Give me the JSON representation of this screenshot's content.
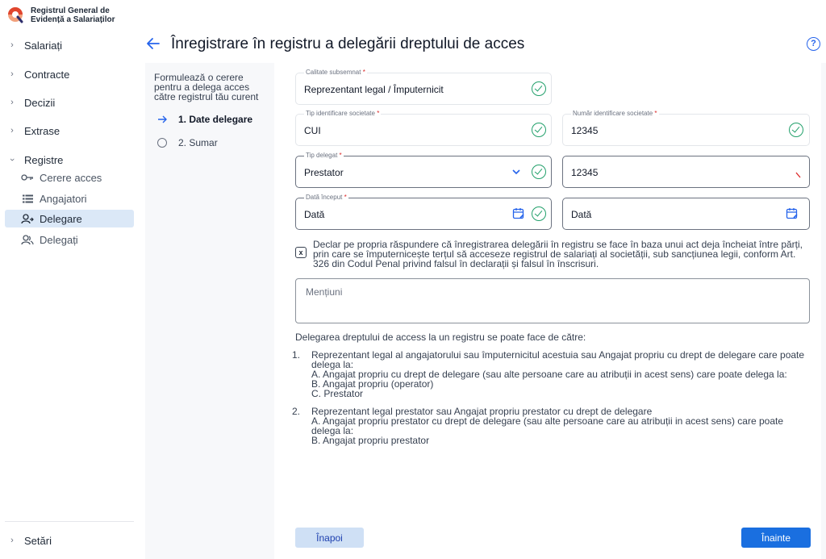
{
  "app": {
    "title_line1": "Registrul General de",
    "title_line2": "Evidență a Salariaților"
  },
  "sidebar": {
    "items": [
      {
        "label": "Salariați"
      },
      {
        "label": "Contracte"
      },
      {
        "label": "Decizii"
      },
      {
        "label": "Extrase"
      },
      {
        "label": "Registre"
      }
    ],
    "sub_items": [
      {
        "label": "Cerere acces",
        "icon": "key-icon"
      },
      {
        "label": "Angajatori",
        "icon": "list-icon"
      },
      {
        "label": "Delegare",
        "icon": "delegate-icon",
        "active": true
      },
      {
        "label": "Delegați",
        "icon": "users-icon"
      }
    ],
    "settings_label": "Setări"
  },
  "header": {
    "title": "Înregistrare în registru a delegării dreptului de acces",
    "help": "?"
  },
  "stepper": {
    "description": "Formulează o cerere pentru a delega acces către registrul tău curent",
    "steps": [
      {
        "label": "1. Date delegare",
        "active": true
      },
      {
        "label": "2. Sumar",
        "active": false
      }
    ]
  },
  "form": {
    "calitate": {
      "label": "Calitate subsemnat",
      "value": "Reprezentant legal / Împuternicit"
    },
    "tip_identificare": {
      "label": "Tip identificare societate",
      "value": "CUI"
    },
    "numar_identificare": {
      "label": "Număr identificare societate",
      "value": "12345"
    },
    "tip_delegat": {
      "label": "Tip delegat",
      "value": "Prestator"
    },
    "delegat_id": {
      "value": "12345"
    },
    "data_inceput": {
      "label": "Dată început",
      "value": "Dată"
    },
    "data_sfarsit": {
      "value": "Dată"
    },
    "required_mark": "*",
    "declaration_checked": "x",
    "declaration": "Declar pe propria răspundere că înregistrarea delegării în registru se face în baza unui act deja încheiat între părți, prin care se împuternicește terțul să acceseze registrul de salariați al societății, sub sancțiunea legii, conform Art. 326 din Codul Penal privind falsul în declarații și falsul în înscrisuri.",
    "mentiuni_placeholder": "Mențiuni"
  },
  "info": {
    "title": "Delegarea dreptului de access la un registru se poate face de către:",
    "items": [
      {
        "num": "1.",
        "text": "Reprezentant legal al angajatorului sau împuternicitul acestuia sau Angajat propriu cu drept de delegare care poate delega la:",
        "subs": [
          "A. Angajat propriu cu drept de delegare (sau alte persoane care au atribuții in acest sens) care poate delega la:",
          "B. Angajat propriu (operator)",
          "C. Prestator"
        ]
      },
      {
        "num": "2.",
        "text": "Reprezentant legal prestator sau Angajat propriu prestator cu drept de delegare",
        "subs": [
          "A. Angajat propriu prestator cu drept de delegare (sau alte persoane care au atribuții in acest sens) care poate delega la:",
          "B. Angajat propriu prestator"
        ]
      }
    ]
  },
  "buttons": {
    "back": "Înapoi",
    "next": "Înainte"
  },
  "colors": {
    "accent": "#1a6fe0",
    "success": "#22a06b",
    "required": "#dc2626"
  }
}
